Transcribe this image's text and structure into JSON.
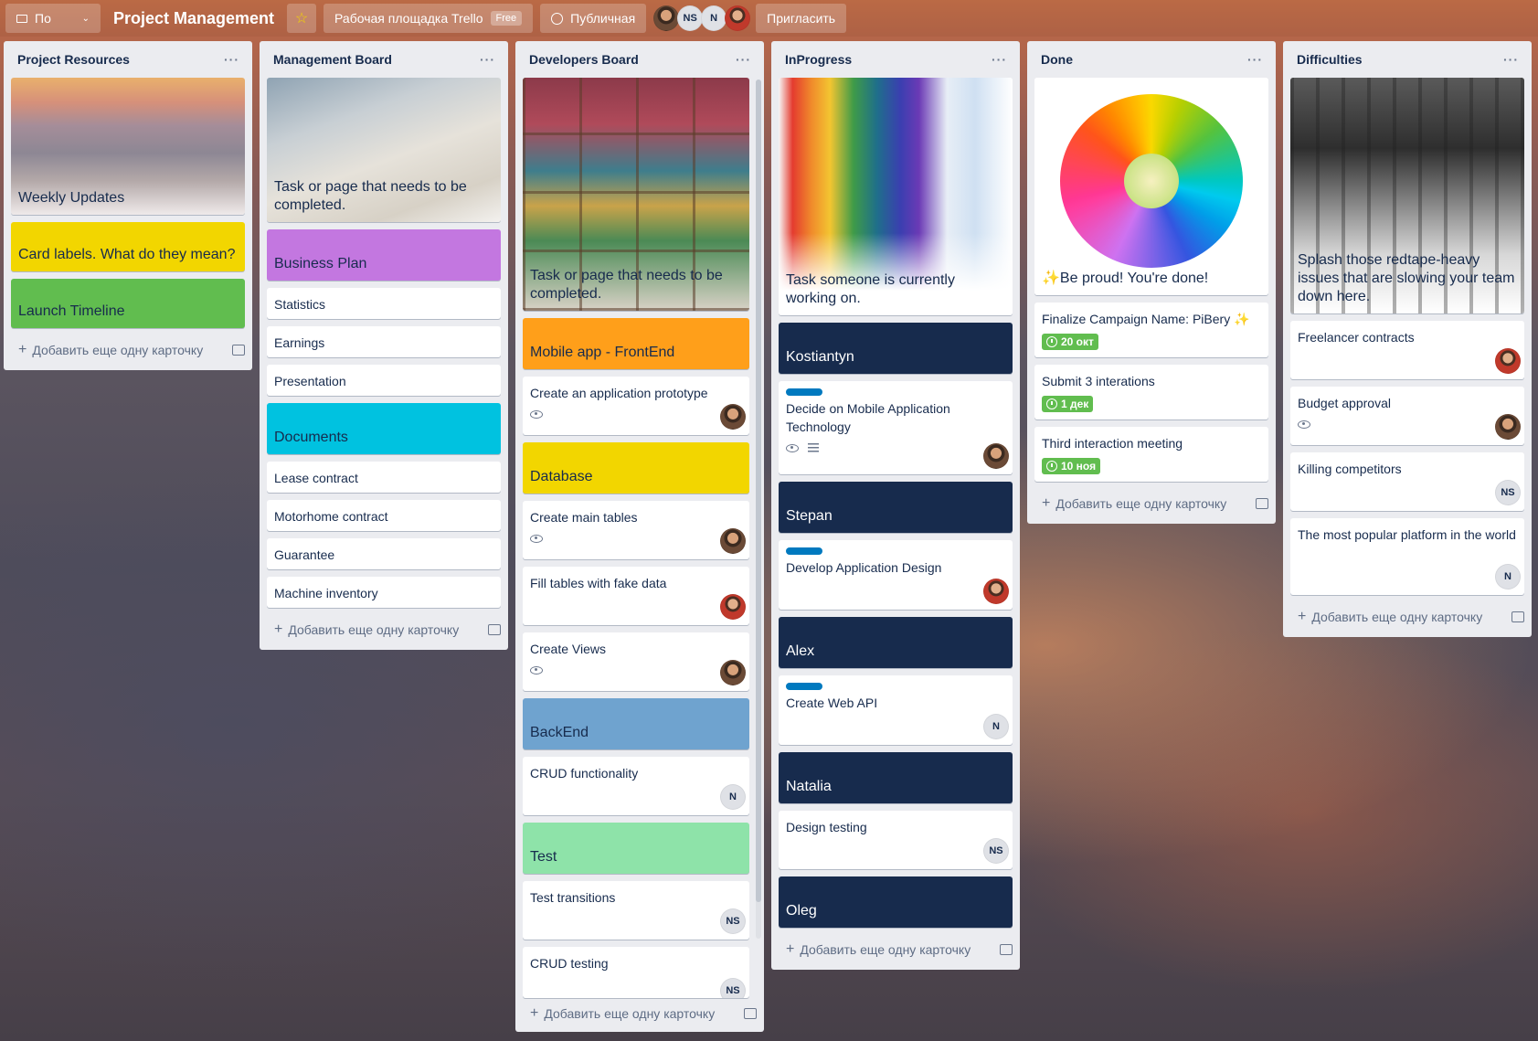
{
  "topbar": {
    "board_menu_label": "По",
    "board_title": "Project Management",
    "star_icon": "star-icon",
    "workspace_label": "Рабочая площадка Trello",
    "workspace_plan": "Free",
    "visibility_label": "Публичная",
    "members": [
      "",
      "NS",
      "N",
      ""
    ],
    "invite_label": "Пригласить"
  },
  "lists": [
    {
      "title": "Project Resources",
      "cards": [
        {
          "title": "Weekly Updates"
        },
        {
          "title": "Card labels. What do they mean?"
        },
        {
          "title": "Launch Timeline"
        }
      ],
      "add_label": "Добавить еще одну карточку"
    },
    {
      "title": "Management Board",
      "cards": [
        {
          "title": "Task or page that needs to be completed."
        },
        {
          "title": "Business Plan"
        },
        {
          "title": "Statistics"
        },
        {
          "title": "Earnings"
        },
        {
          "title": "Presentation"
        },
        {
          "title": "Documents"
        },
        {
          "title": "Lease contract"
        },
        {
          "title": "Motorhome contract"
        },
        {
          "title": "Guarantee"
        },
        {
          "title": "Machine inventory"
        }
      ],
      "add_label": "Добавить еще одну карточку"
    },
    {
      "title": "Developers Board",
      "cards": [
        {
          "title": "Task or page that needs to be completed."
        },
        {
          "title": "Mobile app - FrontEnd"
        },
        {
          "title": "Create an application prototype"
        },
        {
          "title": "Database"
        },
        {
          "title": "Create main tables"
        },
        {
          "title": "Fill tables with fake data"
        },
        {
          "title": "Create Views"
        },
        {
          "title": "BackEnd"
        },
        {
          "title": "CRUD functionality",
          "member": "N"
        },
        {
          "title": "Test"
        },
        {
          "title": "Test transitions",
          "member": "NS"
        },
        {
          "title": "CRUD testing",
          "member": "NS"
        }
      ],
      "add_label": "Добавить еще одну карточку"
    },
    {
      "title": "InProgress",
      "cards": [
        {
          "title": "Task someone is currently working on."
        },
        {
          "title": "Kostiantyn"
        },
        {
          "title": "Decide on Mobile Application Technology"
        },
        {
          "title": "Stepan"
        },
        {
          "title": "Develop Application Design"
        },
        {
          "title": "Alex"
        },
        {
          "title": "Create Web API",
          "member": "N"
        },
        {
          "title": "Natalia"
        },
        {
          "title": "Design testing",
          "member": "NS"
        },
        {
          "title": "Oleg"
        }
      ],
      "add_label": "Добавить еще одну карточку"
    },
    {
      "title": "Done",
      "cards": [
        {
          "title": "✨Be proud! You're done!"
        },
        {
          "title": "Finalize Campaign Name: PiBery ✨",
          "due": "20 окт"
        },
        {
          "title": "Submit 3 interations",
          "due": "1 дек"
        },
        {
          "title": "Third interaction meeting",
          "due": "10 ноя"
        }
      ],
      "add_label": "Добавить еще одну карточку"
    },
    {
      "title": "Difficulties",
      "cards": [
        {
          "title": "Splash those redtape-heavy issues that are slowing your team down here."
        },
        {
          "title": "Freelancer contracts"
        },
        {
          "title": "Budget approval"
        },
        {
          "title": "Killing competitors",
          "member": "NS"
        },
        {
          "title": "The most popular platform in the world",
          "member": "N"
        }
      ],
      "add_label": "Добавить еще одну карточку"
    }
  ],
  "colors": {
    "yellow": "#f2d600",
    "green": "#61bd4f",
    "purple": "#c377e0",
    "sky": "#00c2e0",
    "orange": "#ff9f1a",
    "blue": "#0079bf",
    "lime": "#51e898",
    "navy": "#172b4d"
  }
}
